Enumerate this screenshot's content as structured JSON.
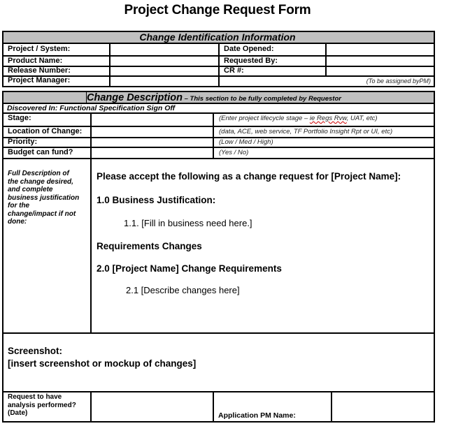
{
  "title": "Project Change Request Form",
  "section1": {
    "header": "Change Identification Information",
    "rows": [
      {
        "left_label": "Project / System:",
        "left_value": "",
        "right_label": "Date Opened:",
        "right_value": ""
      },
      {
        "left_label": "Product Name:",
        "left_value": "",
        "right_label": "Requested By:",
        "right_value": ""
      },
      {
        "left_label": "Release Number:",
        "left_value": "",
        "right_label": "CR #:",
        "right_value": ""
      },
      {
        "left_label": "Project Manager:",
        "left_value": "",
        "right_note": "(To be assigned byPM)"
      }
    ]
  },
  "section2": {
    "header_main": "Change Description",
    "header_sub": " – This section to be fully completed by Requestor",
    "discovered_in": "Discovered In: Functional Specification Sign Off",
    "rows": [
      {
        "label": "Stage:",
        "value": "",
        "hint_prefix": "(Enter project lifecycle stage – ",
        "hint_spell": "ie Regs Rvw",
        "hint_suffix": ", UAT, etc)"
      },
      {
        "label": "Location of Change:",
        "value": "",
        "hint": "(data, ACE, web service, TF Portfolio Insight Rpt or UI, etc)"
      },
      {
        "label": "Priority:",
        "value": "",
        "hint": "(Low / Med / High)"
      },
      {
        "label": "Budget can fund?",
        "value": "",
        "hint": "(Yes / No)"
      }
    ],
    "description": {
      "label_lines": [
        "Full Description of",
        "the change desired,",
        "and complete",
        "business justification",
        "for the",
        "change/impact if not",
        "done:"
      ],
      "intro": "Please accept the following as a change request for [Project Name]:",
      "heading1": "1.0 Business Justification:",
      "item1": "1.1.  [Fill in business need here.]",
      "heading_req": "Requirements Changes",
      "heading2": "2.0  [Project Name]  Change Requirements",
      "item2": "2.1 [Describe changes here]"
    },
    "screenshot": {
      "label": "Screenshot:",
      "placeholder": "[insert screenshot or mockup of changes]"
    },
    "analysis": {
      "label_lines": [
        "Request to have",
        "analysis performed?",
        "(Date)"
      ],
      "value": "",
      "pm_label": "Application PM Name:",
      "pm_value": ""
    }
  }
}
